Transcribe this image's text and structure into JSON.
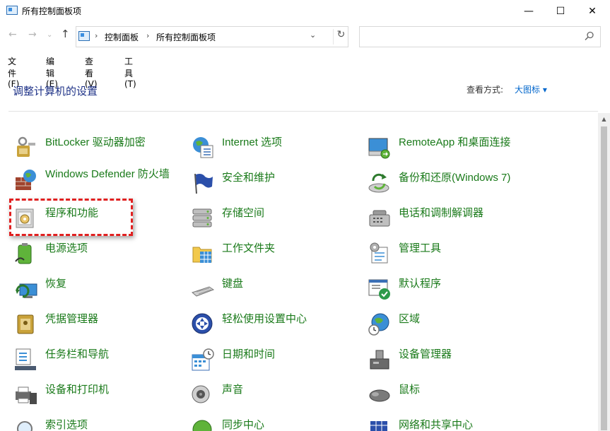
{
  "window": {
    "title": "所有控制面板项",
    "minimize": "—",
    "maximize": "☐",
    "close": "✕"
  },
  "address": {
    "back": "←",
    "forward": "→",
    "recent": "⌄",
    "up": "↑",
    "sep": "›",
    "crumb1": "控制面板",
    "crumb2": "所有控制面板项",
    "dropdown": "⌄",
    "refresh": "↻",
    "search_placeholder": "",
    "search_glyph": "⌕"
  },
  "menu": {
    "file": "文件(F)",
    "edit": "编辑(E)",
    "view": "查看(V)",
    "tools": "工具(T)"
  },
  "content": {
    "title": "调整计算机的设置",
    "viewby_label": "查看方式:",
    "viewby_value": "大图标 ▾"
  },
  "items": {
    "bitlocker": "BitLocker 驱动器加密",
    "internet": "Internet 选项",
    "remoteapp": "RemoteApp 和桌面连接",
    "defender": "Windows Defender 防火墙",
    "security": "安全和维护",
    "backup": "备份和还原(Windows 7)",
    "programs": "程序和功能",
    "storage": "存储空间",
    "phone": "电话和调制解调器",
    "power": "电源选项",
    "workfolders": "工作文件夹",
    "admin": "管理工具",
    "recovery": "恢复",
    "keyboard": "键盘",
    "defaults": "默认程序",
    "credential": "凭据管理器",
    "ease": "轻松使用设置中心",
    "region": "区域",
    "taskbar": "任务栏和导航",
    "datetime": "日期和时间",
    "devmgr": "设备管理器",
    "devices": "设备和打印机",
    "sound": "声音",
    "mouse": "鼠标",
    "indexing": "索引选项",
    "sync": "同步中心",
    "network": "网络和共享中心"
  },
  "colors": {
    "link_green": "#1a7a1a",
    "title_blue": "#1e3287",
    "highlight_red": "#e02020",
    "accent_blue": "#0066cc"
  }
}
